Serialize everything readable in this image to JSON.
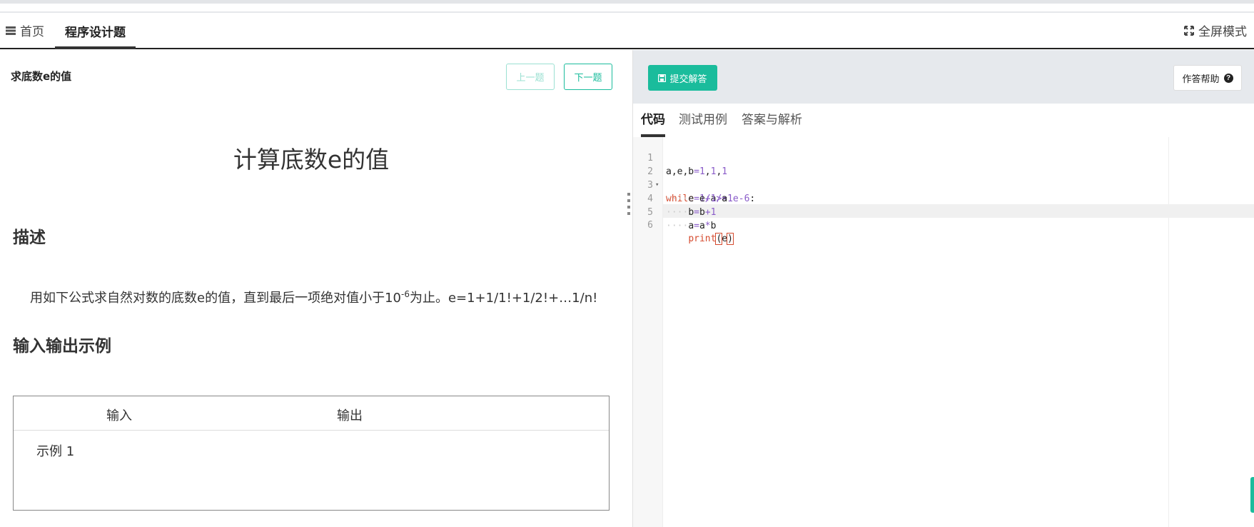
{
  "nav": {
    "home_label": "首页",
    "tab_label": "程序设计题",
    "fullscreen_label": "全屏模式"
  },
  "problem": {
    "short_title": "求底数e的值",
    "prev_label": "上一题",
    "next_label": "下一题",
    "title": "计算底数e的值",
    "desc_heading": "描述",
    "desc_text_1": "用如下公式求自然对数的底数e的值，直到最后一项绝对值小于10",
    "desc_sup": "-6",
    "desc_text_2": "为止。e=1+1/1!+1/2!+…1/n!",
    "io_heading": "输入输出示例",
    "io_input_header": "输入",
    "io_output_header": "输出",
    "io_example_label": "示例 1"
  },
  "editor_panel": {
    "submit_label": "提交解答",
    "help_label": "作答帮助",
    "tabs": [
      {
        "label": "代码",
        "active": true
      },
      {
        "label": "测试用例",
        "active": false
      },
      {
        "label": "答案与解析",
        "active": false
      }
    ],
    "code_lines": [
      "a,e,b=1,1,1",
      "while 1/a>=1e-6:",
      "    e=e+1/a",
      "    b=b+1",
      "    a=a*b",
      "    print(e)"
    ],
    "line_numbers": [
      "1",
      "2",
      "3",
      "4",
      "5",
      "6"
    ]
  },
  "colors": {
    "accent": "#1abc9c",
    "keyword": "#d54b2f",
    "number": "#8a5cc9"
  }
}
